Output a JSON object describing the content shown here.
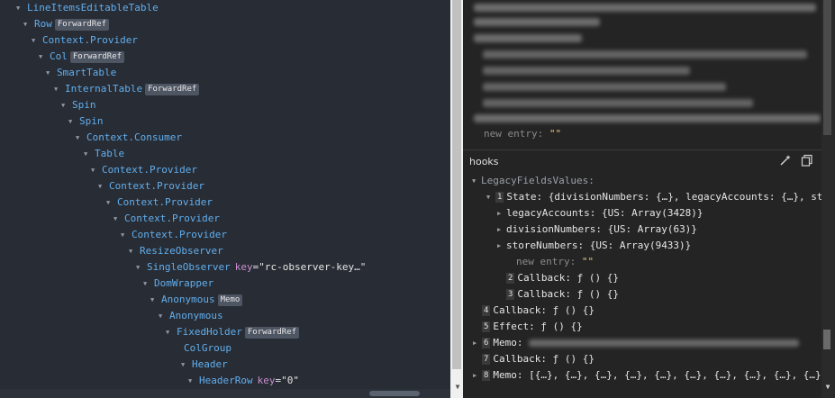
{
  "tree": [
    {
      "name": "LineItemsEditableTable",
      "arrow": "▼",
      "badge": null,
      "key": null,
      "val": null
    },
    {
      "name": "Row",
      "arrow": "▼",
      "badge": "ForwardRef",
      "key": null,
      "val": null
    },
    {
      "name": "Context.Provider",
      "arrow": "▼",
      "badge": null,
      "key": null,
      "val": null
    },
    {
      "name": "Col",
      "arrow": "▼",
      "badge": "ForwardRef",
      "key": null,
      "val": null
    },
    {
      "name": "SmartTable",
      "arrow": "▼",
      "badge": null,
      "key": null,
      "val": null
    },
    {
      "name": "InternalTable",
      "arrow": "▼",
      "badge": "ForwardRef",
      "key": null,
      "val": null
    },
    {
      "name": "Spin",
      "arrow": "▼",
      "badge": null,
      "key": null,
      "val": null
    },
    {
      "name": "Spin",
      "arrow": "▼",
      "badge": null,
      "key": null,
      "val": null
    },
    {
      "name": "Context.Consumer",
      "arrow": "▼",
      "badge": null,
      "key": null,
      "val": null
    },
    {
      "name": "Table",
      "arrow": "▼",
      "badge": null,
      "key": null,
      "val": null
    },
    {
      "name": "Context.Provider",
      "arrow": "▼",
      "badge": null,
      "key": null,
      "val": null
    },
    {
      "name": "Context.Provider",
      "arrow": "▼",
      "badge": null,
      "key": null,
      "val": null
    },
    {
      "name": "Context.Provider",
      "arrow": "▼",
      "badge": null,
      "key": null,
      "val": null
    },
    {
      "name": "Context.Provider",
      "arrow": "▼",
      "badge": null,
      "key": null,
      "val": null
    },
    {
      "name": "Context.Provider",
      "arrow": "▼",
      "badge": null,
      "key": null,
      "val": null
    },
    {
      "name": "ResizeObserver",
      "arrow": "▼",
      "badge": null,
      "key": null,
      "val": null
    },
    {
      "name": "SingleObserver",
      "arrow": "▼",
      "badge": null,
      "key": "key",
      "val": "=\"rc-observer-key…\""
    },
    {
      "name": "DomWrapper",
      "arrow": "▼",
      "badge": null,
      "key": null,
      "val": null
    },
    {
      "name": "Anonymous",
      "arrow": "▼",
      "badge": "Memo",
      "key": null,
      "val": null
    },
    {
      "name": "Anonymous",
      "arrow": "▼",
      "badge": null,
      "key": null,
      "val": null
    },
    {
      "name": "FixedHolder",
      "arrow": "▼",
      "badge": "ForwardRef",
      "key": null,
      "val": null
    },
    {
      "name": "ColGroup",
      "arrow": "",
      "badge": null,
      "key": null,
      "val": null
    },
    {
      "name": "Header",
      "arrow": "▼",
      "badge": null,
      "key": null,
      "val": null
    },
    {
      "name": "HeaderRow",
      "arrow": "▼",
      "badge": null,
      "key": "key",
      "val": "=\"0\""
    }
  ],
  "props": {
    "new_entry_label": "new entry",
    "new_entry_value": "\"\""
  },
  "hooks": {
    "title": "hooks",
    "icons": [
      "magic-wand-icon",
      "copy-icon"
    ],
    "rows": [
      {
        "arrow": "▼",
        "idx": "",
        "key": "LegacyFieldsValues:",
        "val": ""
      },
      {
        "arrow": "▼",
        "idx": "1",
        "key": "State:",
        "val": "{divisionNumbers: {…}, legacyAccounts: {…}, sto…"
      },
      {
        "arrow": "▶",
        "idx": "",
        "key": "legacyAccounts:",
        "val": "{US: Array(3428)}"
      },
      {
        "arrow": "▶",
        "idx": "",
        "key": "divisionNumbers:",
        "val": "{US: Array(63)}"
      },
      {
        "arrow": "▶",
        "idx": "",
        "key": "storeNumbers:",
        "val": "{US: Array(9433)}"
      },
      {
        "arrow": "",
        "idx": "",
        "key": "new entry:",
        "val": "\"\""
      },
      {
        "arrow": "",
        "idx": "2",
        "key": "Callback:",
        "val": "ƒ () {}"
      },
      {
        "arrow": "",
        "idx": "3",
        "key": "Callback:",
        "val": "ƒ () {}"
      },
      {
        "arrow": "",
        "idx": "4",
        "key": "Callback:",
        "val": "ƒ () {}"
      },
      {
        "arrow": "",
        "idx": "5",
        "key": "Effect:",
        "val": "ƒ () {}"
      },
      {
        "arrow": "▶",
        "idx": "6",
        "key": "Memo:",
        "val": ""
      },
      {
        "arrow": "",
        "idx": "7",
        "key": "Callback:",
        "val": "ƒ () {}"
      },
      {
        "arrow": "▶",
        "idx": "8",
        "key": "Memo:",
        "val": "[{…}, {…}, {…}, {…}, {…}, {…}, {…}, {…}, {…}, {…}, …"
      }
    ]
  }
}
